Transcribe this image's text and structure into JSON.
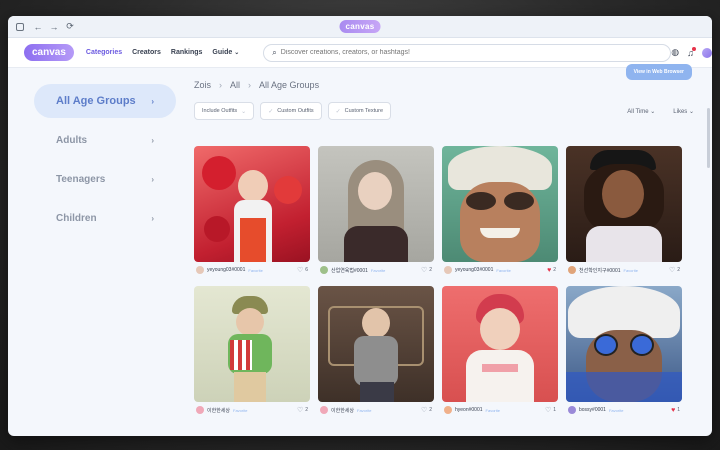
{
  "chrome": {
    "nav": [
      "←",
      "→",
      "⟳"
    ],
    "logo": "canvas"
  },
  "topnav": {
    "brand": "canvas",
    "links": [
      {
        "label": "Categories",
        "active": true
      },
      {
        "label": "Creators",
        "active": false
      },
      {
        "label": "Rankings",
        "active": false
      },
      {
        "label": "Guide",
        "active": false
      }
    ],
    "search_placeholder": "Discover creations, creators, or hashtags!"
  },
  "sidebar": {
    "items": [
      {
        "label": "All Age Groups",
        "active": true
      },
      {
        "label": "Adults",
        "active": false
      },
      {
        "label": "Teenagers",
        "active": false
      },
      {
        "label": "Children",
        "active": false
      }
    ]
  },
  "breadcrumb": [
    "Zois",
    "All",
    "All Age Groups"
  ],
  "web_button": "View in Web Browser",
  "filters": [
    "Include Outfits",
    "Custom Outfits",
    "Custom Texture"
  ],
  "sorts": [
    "All Time",
    "Likes"
  ],
  "cards": [
    {
      "user": "yeyoung03#0001",
      "badge": "Favorite",
      "likes": "6",
      "liked": false,
      "bg": "#d9364a",
      "avatar": "#d8d3cf"
    },
    {
      "user": "산업연육법#0001",
      "badge": "Favorite",
      "likes": "2",
      "liked": false,
      "bg": "#b8b8b2",
      "avatar": "#9ec08a"
    },
    {
      "user": "yeyoung03#0001",
      "badge": "Favorite",
      "likes": "2",
      "liked": true,
      "bg": "#5f9f88",
      "avatar": "#d8d3cf"
    },
    {
      "user": "천선학인지구#0001",
      "badge": "Favorite",
      "likes": "2",
      "liked": false,
      "bg": "#553a2a",
      "avatar": "#e0a47a"
    },
    {
      "user": "이한한세상",
      "badge": "Favorite",
      "likes": "2",
      "liked": false,
      "bg": "#dfe3c9",
      "avatar": "#f0a8b8"
    },
    {
      "user": "이한한세상",
      "badge": "Favorite",
      "likes": "2",
      "liked": false,
      "bg": "#5a4438",
      "avatar": "#f0a8b8"
    },
    {
      "user": "hyeon#0001",
      "badge": "Favorite",
      "likes": "1",
      "liked": false,
      "bg": "#e56262",
      "avatar": "#f0b08a"
    },
    {
      "user": "bossy#0001",
      "badge": "Favorite",
      "likes": "1",
      "liked": true,
      "bg": "#7a9fc4",
      "avatar": "#9a8ad8"
    }
  ]
}
